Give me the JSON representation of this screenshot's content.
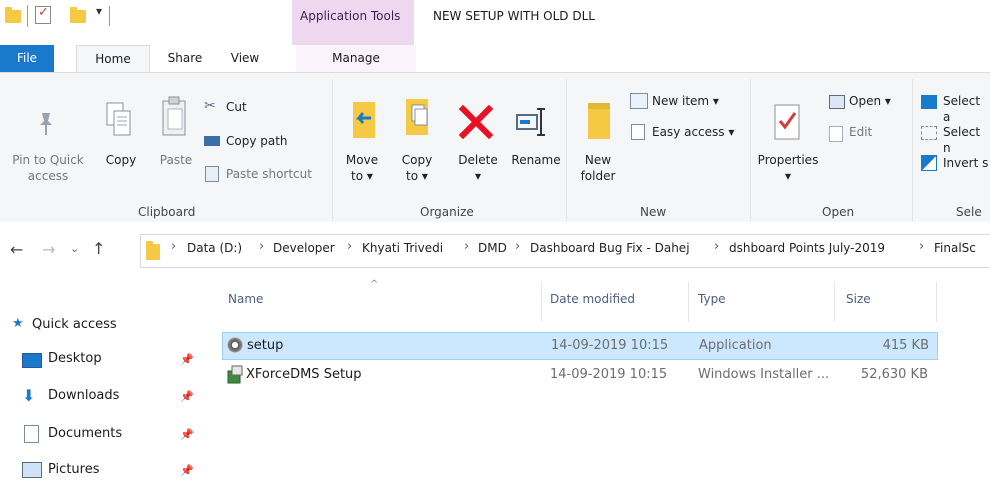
{
  "titlebar": {
    "context_group": "Application Tools",
    "window_title": "NEW SETUP WITH OLD DLL"
  },
  "tabs": {
    "file": "File",
    "home": "Home",
    "share": "Share",
    "view": "View",
    "manage": "Manage"
  },
  "ribbon": {
    "clipboard": {
      "pin_line1": "Pin to Quick",
      "pin_line2": "access",
      "copy": "Copy",
      "paste": "Paste",
      "cut": "Cut",
      "copy_path": "Copy path",
      "paste_shortcut": "Paste shortcut",
      "label": "Clipboard"
    },
    "organize": {
      "move_line1": "Move",
      "move_line2": "to ▾",
      "copy_line1": "Copy",
      "copy_line2": "to ▾",
      "delete": "Delete",
      "delete_arrow": "▾",
      "rename": "Rename",
      "label": "Organize"
    },
    "new": {
      "new_folder_line1": "New",
      "new_folder_line2": "folder",
      "new_item": "New item ▾",
      "easy_access": "Easy access ▾",
      "label": "New"
    },
    "open": {
      "properties": "Properties",
      "properties_arrow": "▾",
      "open": "Open ▾",
      "edit": "Edit",
      "label": "Open"
    },
    "select": {
      "select_all": "Select a",
      "select_none": "Select n",
      "invert": "Invert s",
      "label": "Sele"
    }
  },
  "address": {
    "crumbs": [
      "Data (D:)",
      "Developer",
      "Khyati Trivedi",
      "DMD",
      "Dashboard Bug Fix - Dahej",
      "dshboard Points July-2019",
      "FinalSc"
    ]
  },
  "nav": {
    "quick_access": "Quick access",
    "items": [
      {
        "label": "Desktop",
        "icon": "desktop-icon"
      },
      {
        "label": "Downloads",
        "icon": "downloads-icon"
      },
      {
        "label": "Documents",
        "icon": "documents-icon"
      },
      {
        "label": "Pictures",
        "icon": "pictures-icon"
      }
    ]
  },
  "list": {
    "columns": [
      "Name",
      "Date modified",
      "Type",
      "Size"
    ],
    "rows": [
      {
        "name": "setup",
        "date": "14-09-2019 10:15",
        "type": "Application",
        "size": "415 KB",
        "selected": true
      },
      {
        "name": "XForceDMS Setup",
        "date": "14-09-2019 10:15",
        "type": "Windows Installer ...",
        "size": "52,630 KB",
        "selected": false
      }
    ]
  },
  "colors": {
    "file_tab": "#1979ca",
    "context_tools": "#eed8f0",
    "selected_row": "#cce8ff",
    "delete_red": "#e81123"
  }
}
